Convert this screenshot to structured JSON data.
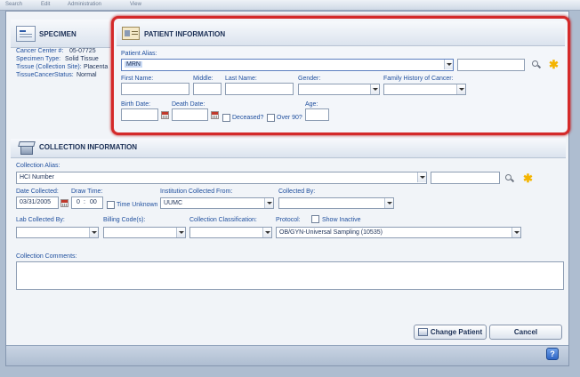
{
  "menu": {
    "items": [
      "Search",
      "Edit",
      "Administration",
      "View"
    ]
  },
  "specimen": {
    "title": "SPECIMEN",
    "rows": [
      {
        "label": "Cancer Center #:",
        "value": "05-07725"
      },
      {
        "label": "Specimen Type:",
        "value": "Solid Tissue"
      },
      {
        "label": "Tissue (Collection Site):",
        "value": "Placenta"
      },
      {
        "label": "TissueCancerStatus:",
        "value": "Normal"
      }
    ]
  },
  "patient": {
    "title": "PATIENT INFORMATION",
    "alias_label": "Patient Alias:",
    "alias_value": "MRN",
    "first_name_label": "First Name:",
    "middle_label": "Middle:",
    "last_name_label": "Last Name:",
    "gender_label": "Gender:",
    "family_history_label": "Family History of Cancer:",
    "birth_date_label": "Birth Date:",
    "death_date_label": "Death Date:",
    "deceased_label": "Deceased?",
    "over90_label": "Over 90?",
    "age_label": "Age:"
  },
  "collection": {
    "title": "COLLECTION INFORMATION",
    "alias_label": "Collection Alias:",
    "alias_value": "HCI Number",
    "date_collected_label": "Date Collected:",
    "date_collected_value": "03/31/2005",
    "draw_time_label": "Draw Time:",
    "draw_time_hour": "0",
    "draw_time_minute": "00",
    "time_unknown_label": "Time Unknown",
    "institution_label": "Institution Collected From:",
    "institution_value": "UUMC",
    "collected_by_label": "Collected By:",
    "lab_collected_by_label": "Lab Collected By:",
    "billing_codes_label": "Billing Code(s):",
    "classification_label": "Collection Classification:",
    "protocol_label": "Protocol:",
    "show_inactive_label": "Show Inactive",
    "protocol_value": "OB/GYN-Universal Sampling (10535)",
    "comments_label": "Collection Comments:"
  },
  "buttons": {
    "change_patient": "Change Patient",
    "cancel": "Cancel",
    "help": "?"
  },
  "colors": {
    "highlight_border": "#d42a2a",
    "label_blue": "#1f4f9e",
    "star": "#f4b400"
  },
  "icons": [
    "specimen-icon",
    "patient-card-icon",
    "collection-box-icon",
    "search-icon",
    "add-star-icon",
    "calendar-icon",
    "help-icon",
    "change-patient-icon"
  ]
}
